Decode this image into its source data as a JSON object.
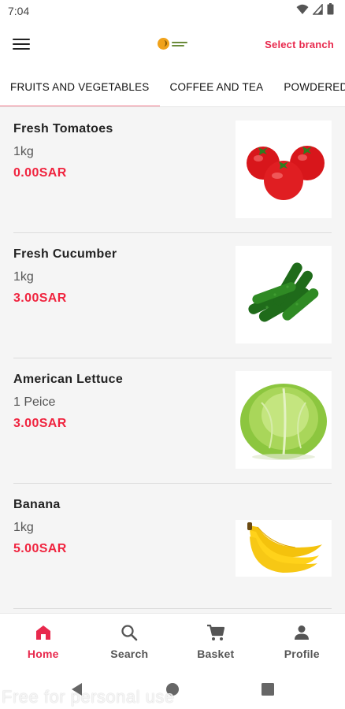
{
  "status_bar": {
    "time": "7:04",
    "icons": [
      "wifi-icon",
      "signal-icon",
      "battery-icon"
    ]
  },
  "app_bar": {
    "menu_icon": "hamburger-menu-icon",
    "logo": "store-logo",
    "select_branch_label": "Select branch"
  },
  "tabs": [
    {
      "label": "FRUITS AND VEGETABLES",
      "active": true
    },
    {
      "label": "COFFEE AND TEA",
      "active": false
    },
    {
      "label": "POWDERED",
      "active": false
    }
  ],
  "products": [
    {
      "name": "Fresh Tomatoes",
      "unit": "1kg",
      "price": "0.00SAR",
      "image": "tomatoes-image"
    },
    {
      "name": "Fresh Cucumber",
      "unit": "1kg",
      "price": "3.00SAR",
      "image": "cucumbers-image"
    },
    {
      "name": "American Lettuce",
      "unit": "1 Peice",
      "price": "3.00SAR",
      "image": "lettuce-image"
    },
    {
      "name": "Banana",
      "unit": "1kg",
      "price": "5.00SAR",
      "image": "banana-image"
    }
  ],
  "bottom_nav": [
    {
      "label": "Home",
      "icon": "home-icon",
      "active": true
    },
    {
      "label": "Search",
      "icon": "search-icon",
      "active": false
    },
    {
      "label": "Basket",
      "icon": "cart-icon",
      "active": false
    },
    {
      "label": "Profile",
      "icon": "person-icon",
      "active": false
    }
  ],
  "system_nav": [
    "back-icon",
    "home-circle-icon",
    "recents-icon"
  ],
  "watermark": "Free for personal use",
  "colors": {
    "accent": "#e8294d",
    "price": "#f0243f",
    "tab_indicator": "#f07b8d",
    "background": "#f5f5f5"
  }
}
